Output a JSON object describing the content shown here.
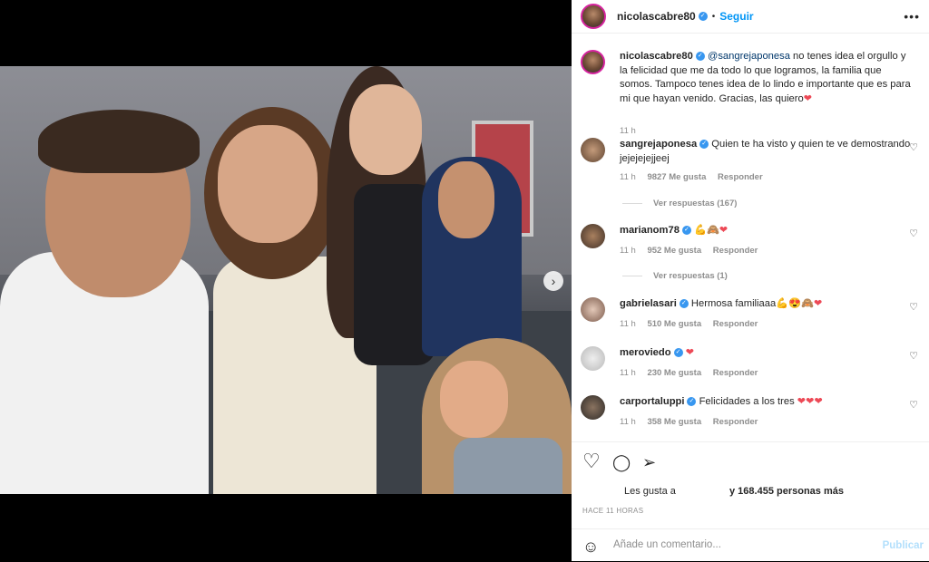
{
  "post": {
    "author": "nicolascabre80",
    "follow_label": "Seguir",
    "caption_mention": "@sangrejaponesa",
    "caption_text": " no tenes idea el orgullo y la felicidad que me da todo lo que logramos, la familia que somos. Tampoco tenes idea de lo lindo e importante que es para mi que hayan venido. Gracias, las quiero",
    "caption_time": "11 h"
  },
  "comments": [
    {
      "user": "sangrejaponesa",
      "text": "Quien te ha visto y quien te ve demostrando jejejejejjeej",
      "time": "11 h",
      "likes": "9827 Me gusta",
      "reply": "Responder",
      "view_replies": "Ver respuestas (167)"
    },
    {
      "user": "marianom78",
      "text": "💪🙈",
      "time": "11 h",
      "likes": "952 Me gusta",
      "reply": "Responder",
      "view_replies": "Ver respuestas (1)"
    },
    {
      "user": "gabrielasari",
      "text": "Hermosa familiaaa💪😍🙈",
      "time": "11 h",
      "likes": "510 Me gusta",
      "reply": "Responder"
    },
    {
      "user": "meroviedo",
      "text": "",
      "time": "11 h",
      "likes": "230 Me gusta",
      "reply": "Responder"
    },
    {
      "user": "carportaluppi",
      "text": "Felicidades a los tres",
      "time": "11 h",
      "likes": "358 Me gusta",
      "reply": "Responder"
    }
  ],
  "likes": {
    "prefix": "Les gusta a",
    "suffix": "y 168.455 personas más"
  },
  "time_ago": "HACE 11 HORAS",
  "add_comment": {
    "placeholder": "Añade un comentario...",
    "publish_label": "Publicar"
  },
  "icons": {
    "heart": "♡",
    "comment": "◯",
    "share": "➢",
    "emoji": "☺",
    "next": "›",
    "more": "•••"
  },
  "colors": {
    "accent": "#0095f6",
    "verified": "#3897f0",
    "heart_red": "#ed4956"
  }
}
